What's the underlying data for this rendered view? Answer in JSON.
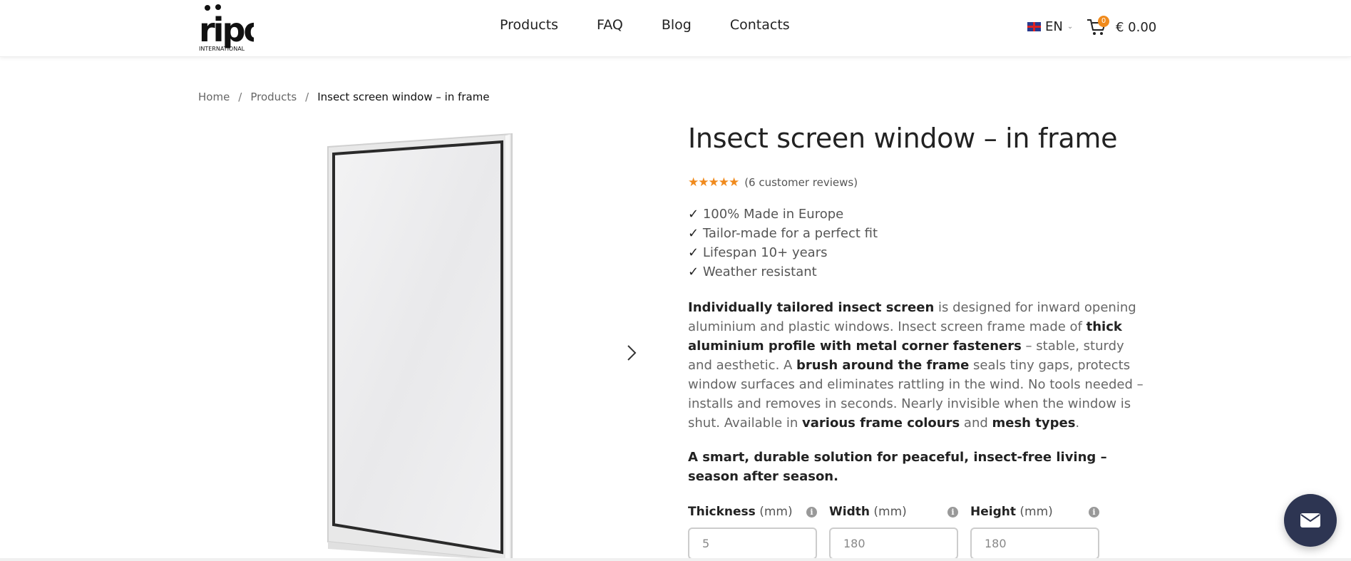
{
  "header": {
    "logo_text": "ripo",
    "logo_subtext": "INTERNATIONAL",
    "nav": [
      {
        "label": "Products"
      },
      {
        "label": "FAQ"
      },
      {
        "label": "Blog"
      },
      {
        "label": "Contacts"
      }
    ],
    "language": "EN",
    "cart_count": "0",
    "cart_total": "€ 0.00"
  },
  "breadcrumb": {
    "home": "Home",
    "sep": "/",
    "products": "Products",
    "current": "Insect screen window – in frame"
  },
  "product": {
    "title": "Insect screen window – in frame",
    "rating_value": 5,
    "stars": "★★★★★",
    "reviews": "(6 customer reviews)",
    "check": "✓",
    "features": [
      "100% Made in Europe",
      "Tailor-made for a perfect fit",
      "Lifespan 10+ years",
      "Weather resistant"
    ],
    "desc": {
      "b1": "Individually tailored insect screen",
      "t1": " is designed for inward opening aluminium and plastic windows. Insect screen frame made of ",
      "b2": "thick aluminium profile with metal corner fasteners",
      "t2": " – stable, sturdy and aesthetic. A ",
      "b3": "brush around the frame",
      "t3": " seals tiny gaps, protects window surfaces and eliminates rattling in the wind. No tools needed – installs and removes in seconds. Nearly invisible when the window is shut. Available in ",
      "b4": "various frame colours",
      "t4": " and ",
      "b5": "mesh types",
      "t5": "."
    },
    "tagline": "A smart, durable solution for peaceful, insect-free living – season after season.",
    "dimensions": [
      {
        "name": "Thickness",
        "unit": "(mm)",
        "value": "5"
      },
      {
        "name": "Width",
        "unit": "(mm)",
        "value": "180"
      },
      {
        "name": "Height",
        "unit": "(mm)",
        "value": "180"
      }
    ],
    "info_glyph": "i"
  },
  "colors": {
    "accent": "#f08a1c",
    "chat_button": "#2d3552"
  }
}
